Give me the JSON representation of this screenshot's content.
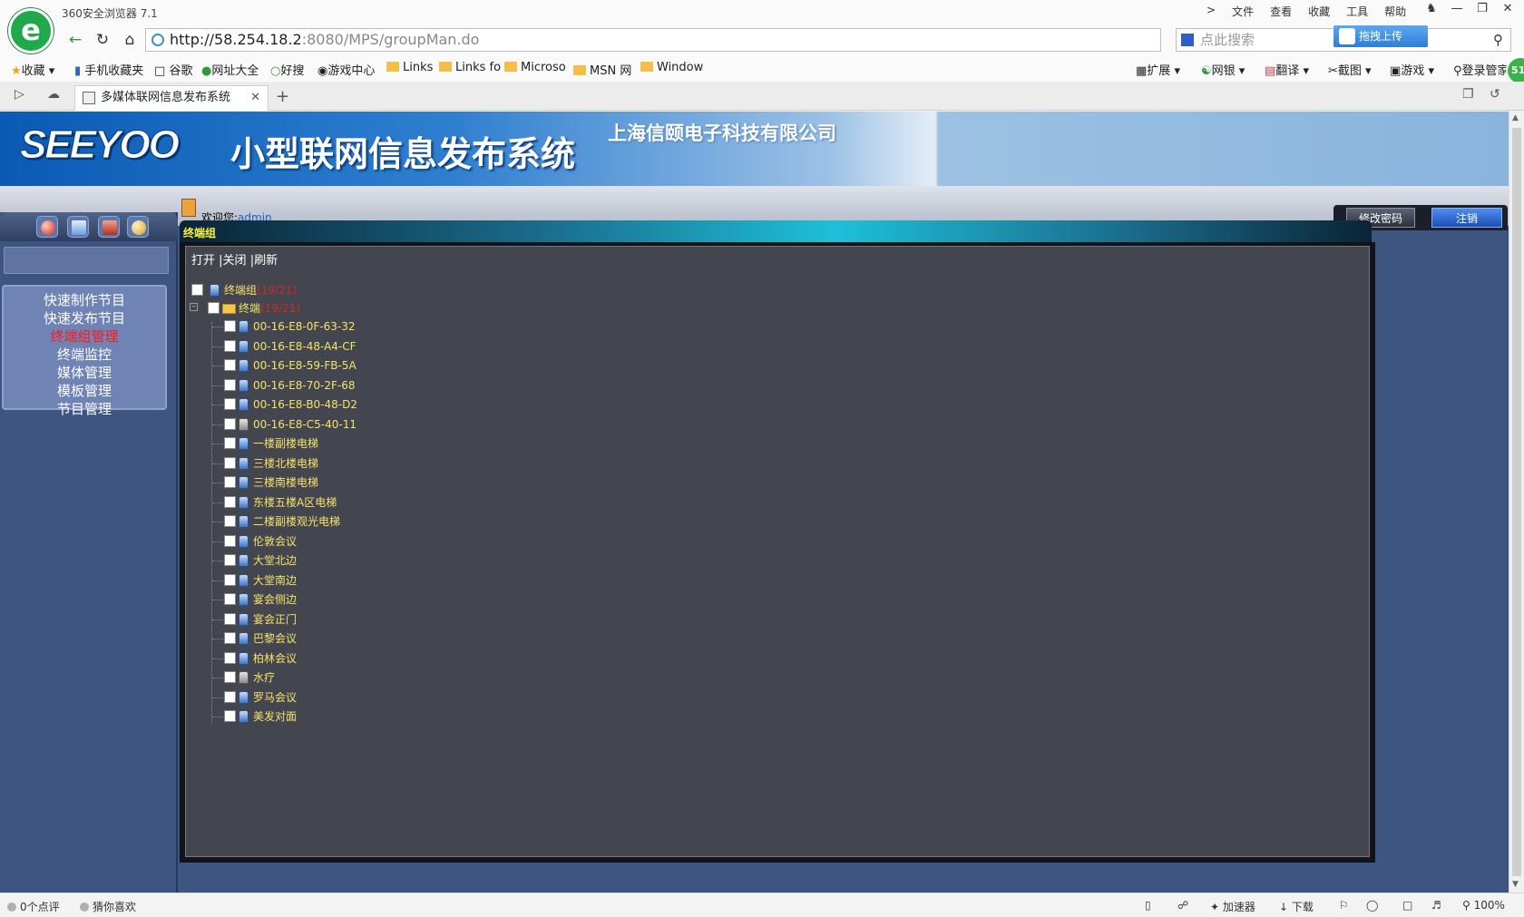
{
  "browser": {
    "app_title": "360安全浏览器 7.1",
    "menu": [
      "文件",
      "查看",
      "收藏",
      "工具",
      "帮助"
    ],
    "address": {
      "host": "http://58.254.18.2",
      "path": ":8080/MPS/groupMan.do"
    },
    "search_placeholder": "点此搜索",
    "upload_label": "拖拽上传",
    "badge": "51",
    "bookmarks": [
      "收藏",
      "手机收藏夹",
      "谷歌",
      "网址大全",
      "好搜",
      "游戏中心",
      "Links",
      "Links fo",
      "Microso",
      "MSN 网",
      "Window"
    ],
    "toolbar_right": [
      "扩展",
      "网银",
      "翻译",
      "截图",
      "游戏",
      "登录管家"
    ],
    "tab_title": "多媒体联网信息发布系统",
    "statusbar": {
      "comments": "0个点评",
      "guess": "猜你喜欢",
      "accelerator": "加速器",
      "download": "下载",
      "zoom": "100%"
    }
  },
  "header": {
    "logo": "SEEYOO",
    "system_title": "小型联网信息发布系统",
    "company": "上海信颐电子科技有限公司",
    "welcome_prefix": "欢迎您:",
    "username": "admin",
    "change_password": "修改密码",
    "logout": "注销"
  },
  "nav": {
    "icons": [
      "home-icon",
      "monitor-icon",
      "gift-icon",
      "close-icon"
    ],
    "items": [
      "快速制作节目",
      "快速发布节目",
      "终端组管理",
      "终端监控",
      "媒体管理",
      "模板管理",
      "节目管理"
    ],
    "active_index": 2
  },
  "panel": {
    "title": "终端组",
    "actions": [
      "打开",
      "关闭",
      "刷新"
    ],
    "root": {
      "label": "终端组",
      "count": "(19/21)"
    },
    "group": {
      "label": "终端",
      "count": "(19/21)"
    },
    "terminals": [
      {
        "name": "00-16-E8-0F-63-32",
        "online": true
      },
      {
        "name": "00-16-E8-48-A4-CF",
        "online": true
      },
      {
        "name": "00-16-E8-59-FB-5A",
        "online": true
      },
      {
        "name": "00-16-E8-70-2F-68",
        "online": true
      },
      {
        "name": "00-16-E8-B0-48-D2",
        "online": true
      },
      {
        "name": "00-16-E8-C5-40-11",
        "online": false
      },
      {
        "name": "一楼副楼电梯",
        "online": true
      },
      {
        "name": "三楼北楼电梯",
        "online": true
      },
      {
        "name": "三楼南楼电梯",
        "online": true
      },
      {
        "name": "东楼五楼A区电梯",
        "online": true
      },
      {
        "name": "二楼副楼观光电梯",
        "online": true
      },
      {
        "name": "伦敦会议",
        "online": true
      },
      {
        "name": "大堂北边",
        "online": true
      },
      {
        "name": "大堂南边",
        "online": true
      },
      {
        "name": "宴会侧边",
        "online": true
      },
      {
        "name": "宴会正门",
        "online": true
      },
      {
        "name": "巴黎会议",
        "online": true
      },
      {
        "name": "柏林会议",
        "online": true
      },
      {
        "name": "水疗",
        "online": false
      },
      {
        "name": "罗马会议",
        "online": true
      },
      {
        "name": "美发对面",
        "online": true
      }
    ]
  }
}
